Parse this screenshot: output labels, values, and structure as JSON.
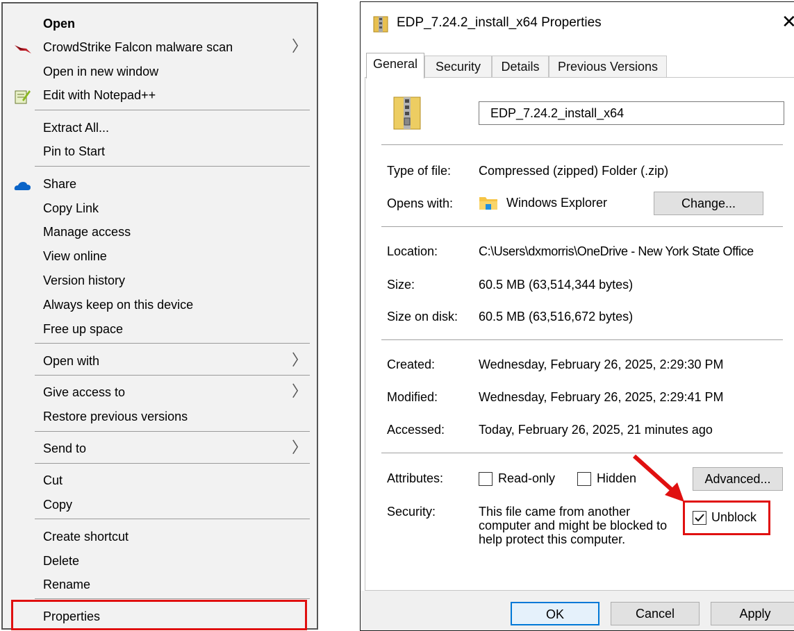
{
  "context_menu": {
    "items": [
      {
        "label": "Open",
        "icon": "",
        "submenu": false
      },
      {
        "label": "CrowdStrike Falcon malware scan",
        "icon": "crowdstrike-falcon-icon",
        "submenu": true
      },
      {
        "label": "Open in new window",
        "icon": "",
        "submenu": false
      },
      {
        "label": "Edit with Notepad++",
        "icon": "notepad-plus-plus-icon",
        "submenu": false
      },
      {
        "label": "Extract All...",
        "icon": "",
        "submenu": false
      },
      {
        "label": "Pin to Start",
        "icon": "",
        "submenu": false
      },
      {
        "label": "Share",
        "icon": "onedrive-cloud-icon",
        "submenu": false
      },
      {
        "label": "Copy Link",
        "icon": "",
        "submenu": false
      },
      {
        "label": "Manage access",
        "icon": "",
        "submenu": false
      },
      {
        "label": "View online",
        "icon": "",
        "submenu": false
      },
      {
        "label": "Version history",
        "icon": "",
        "submenu": false
      },
      {
        "label": "Always keep on this device",
        "icon": "",
        "submenu": false
      },
      {
        "label": "Free up space",
        "icon": "",
        "submenu": false
      },
      {
        "label": "Open with",
        "icon": "",
        "submenu": true
      },
      {
        "label": "Give access to",
        "icon": "",
        "submenu": true
      },
      {
        "label": "Restore previous versions",
        "icon": "",
        "submenu": false
      },
      {
        "label": "Send to",
        "icon": "",
        "submenu": true
      },
      {
        "label": "Cut",
        "icon": "",
        "submenu": false
      },
      {
        "label": "Copy",
        "icon": "",
        "submenu": false
      },
      {
        "label": "Create shortcut",
        "icon": "",
        "submenu": false
      },
      {
        "label": "Delete",
        "icon": "",
        "submenu": false
      },
      {
        "label": "Rename",
        "icon": "",
        "submenu": false
      },
      {
        "label": "Properties",
        "icon": "",
        "submenu": false
      }
    ],
    "highlighted": "Properties",
    "highlight_color": "#e01010"
  },
  "dialog": {
    "title": "EDP_7.24.2_install_x64 Properties",
    "close_glyph": "✕",
    "tabs": [
      "General",
      "Security",
      "Details",
      "Previous Versions"
    ],
    "active_tab": "General",
    "file_name": "EDP_7.24.2_install_x64",
    "type_label": "Type of file:",
    "type_value": "Compressed (zipped) Folder (.zip)",
    "opens_label": "Opens with:",
    "opens_value": "Windows Explorer",
    "change_button": "Change...",
    "location_label": "Location:",
    "location_value": "C:\\Users\\dxmorris\\OneDrive - New York State Office",
    "size_label": "Size:",
    "size_value": "60.5 MB (63,514,344 bytes)",
    "size_disk_label": "Size on disk:",
    "size_disk_value": "60.5 MB (63,516,672 bytes)",
    "created_label": "Created:",
    "created_value": "Wednesday, February 26, 2025, 2:29:30 PM",
    "modified_label": "Modified:",
    "modified_value": "Wednesday, February 26, 2025, 2:29:41 PM",
    "accessed_label": "Accessed:",
    "accessed_value": "Today, February 26, 2025, 21 minutes ago",
    "attributes_label": "Attributes:",
    "readonly_label": "Read-only",
    "readonly_checked": false,
    "hidden_label": "Hidden",
    "hidden_checked": false,
    "advanced_button": "Advanced...",
    "security_label": "Security:",
    "security_text_1": "This file came from another",
    "security_text_2": "computer and might be blocked to",
    "security_text_3": "help protect this computer.",
    "unblock_label": "Unblock",
    "unblock_checked": true,
    "ok_button": "OK",
    "cancel_button": "Cancel",
    "apply_button": "Apply",
    "accent_color": "#0078d7",
    "annotation_color": "#e01010"
  }
}
